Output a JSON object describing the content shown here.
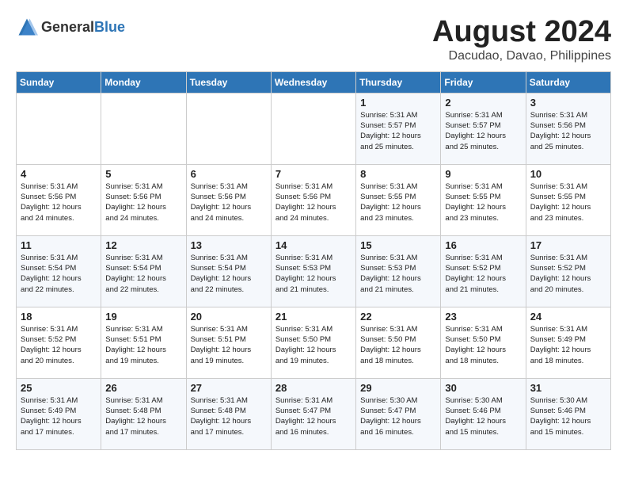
{
  "logo": {
    "general": "General",
    "blue": "Blue"
  },
  "header": {
    "month_year": "August 2024",
    "location": "Dacudao, Davao, Philippines"
  },
  "weekdays": [
    "Sunday",
    "Monday",
    "Tuesday",
    "Wednesday",
    "Thursday",
    "Friday",
    "Saturday"
  ],
  "weeks": [
    [
      {
        "day": "",
        "info": ""
      },
      {
        "day": "",
        "info": ""
      },
      {
        "day": "",
        "info": ""
      },
      {
        "day": "",
        "info": ""
      },
      {
        "day": "1",
        "info": "Sunrise: 5:31 AM\nSunset: 5:57 PM\nDaylight: 12 hours\nand 25 minutes."
      },
      {
        "day": "2",
        "info": "Sunrise: 5:31 AM\nSunset: 5:57 PM\nDaylight: 12 hours\nand 25 minutes."
      },
      {
        "day": "3",
        "info": "Sunrise: 5:31 AM\nSunset: 5:56 PM\nDaylight: 12 hours\nand 25 minutes."
      }
    ],
    [
      {
        "day": "4",
        "info": "Sunrise: 5:31 AM\nSunset: 5:56 PM\nDaylight: 12 hours\nand 24 minutes."
      },
      {
        "day": "5",
        "info": "Sunrise: 5:31 AM\nSunset: 5:56 PM\nDaylight: 12 hours\nand 24 minutes."
      },
      {
        "day": "6",
        "info": "Sunrise: 5:31 AM\nSunset: 5:56 PM\nDaylight: 12 hours\nand 24 minutes."
      },
      {
        "day": "7",
        "info": "Sunrise: 5:31 AM\nSunset: 5:56 PM\nDaylight: 12 hours\nand 24 minutes."
      },
      {
        "day": "8",
        "info": "Sunrise: 5:31 AM\nSunset: 5:55 PM\nDaylight: 12 hours\nand 23 minutes."
      },
      {
        "day": "9",
        "info": "Sunrise: 5:31 AM\nSunset: 5:55 PM\nDaylight: 12 hours\nand 23 minutes."
      },
      {
        "day": "10",
        "info": "Sunrise: 5:31 AM\nSunset: 5:55 PM\nDaylight: 12 hours\nand 23 minutes."
      }
    ],
    [
      {
        "day": "11",
        "info": "Sunrise: 5:31 AM\nSunset: 5:54 PM\nDaylight: 12 hours\nand 22 minutes."
      },
      {
        "day": "12",
        "info": "Sunrise: 5:31 AM\nSunset: 5:54 PM\nDaylight: 12 hours\nand 22 minutes."
      },
      {
        "day": "13",
        "info": "Sunrise: 5:31 AM\nSunset: 5:54 PM\nDaylight: 12 hours\nand 22 minutes."
      },
      {
        "day": "14",
        "info": "Sunrise: 5:31 AM\nSunset: 5:53 PM\nDaylight: 12 hours\nand 21 minutes."
      },
      {
        "day": "15",
        "info": "Sunrise: 5:31 AM\nSunset: 5:53 PM\nDaylight: 12 hours\nand 21 minutes."
      },
      {
        "day": "16",
        "info": "Sunrise: 5:31 AM\nSunset: 5:52 PM\nDaylight: 12 hours\nand 21 minutes."
      },
      {
        "day": "17",
        "info": "Sunrise: 5:31 AM\nSunset: 5:52 PM\nDaylight: 12 hours\nand 20 minutes."
      }
    ],
    [
      {
        "day": "18",
        "info": "Sunrise: 5:31 AM\nSunset: 5:52 PM\nDaylight: 12 hours\nand 20 minutes."
      },
      {
        "day": "19",
        "info": "Sunrise: 5:31 AM\nSunset: 5:51 PM\nDaylight: 12 hours\nand 19 minutes."
      },
      {
        "day": "20",
        "info": "Sunrise: 5:31 AM\nSunset: 5:51 PM\nDaylight: 12 hours\nand 19 minutes."
      },
      {
        "day": "21",
        "info": "Sunrise: 5:31 AM\nSunset: 5:50 PM\nDaylight: 12 hours\nand 19 minutes."
      },
      {
        "day": "22",
        "info": "Sunrise: 5:31 AM\nSunset: 5:50 PM\nDaylight: 12 hours\nand 18 minutes."
      },
      {
        "day": "23",
        "info": "Sunrise: 5:31 AM\nSunset: 5:50 PM\nDaylight: 12 hours\nand 18 minutes."
      },
      {
        "day": "24",
        "info": "Sunrise: 5:31 AM\nSunset: 5:49 PM\nDaylight: 12 hours\nand 18 minutes."
      }
    ],
    [
      {
        "day": "25",
        "info": "Sunrise: 5:31 AM\nSunset: 5:49 PM\nDaylight: 12 hours\nand 17 minutes."
      },
      {
        "day": "26",
        "info": "Sunrise: 5:31 AM\nSunset: 5:48 PM\nDaylight: 12 hours\nand 17 minutes."
      },
      {
        "day": "27",
        "info": "Sunrise: 5:31 AM\nSunset: 5:48 PM\nDaylight: 12 hours\nand 17 minutes."
      },
      {
        "day": "28",
        "info": "Sunrise: 5:31 AM\nSunset: 5:47 PM\nDaylight: 12 hours\nand 16 minutes."
      },
      {
        "day": "29",
        "info": "Sunrise: 5:30 AM\nSunset: 5:47 PM\nDaylight: 12 hours\nand 16 minutes."
      },
      {
        "day": "30",
        "info": "Sunrise: 5:30 AM\nSunset: 5:46 PM\nDaylight: 12 hours\nand 15 minutes."
      },
      {
        "day": "31",
        "info": "Sunrise: 5:30 AM\nSunset: 5:46 PM\nDaylight: 12 hours\nand 15 minutes."
      }
    ]
  ]
}
